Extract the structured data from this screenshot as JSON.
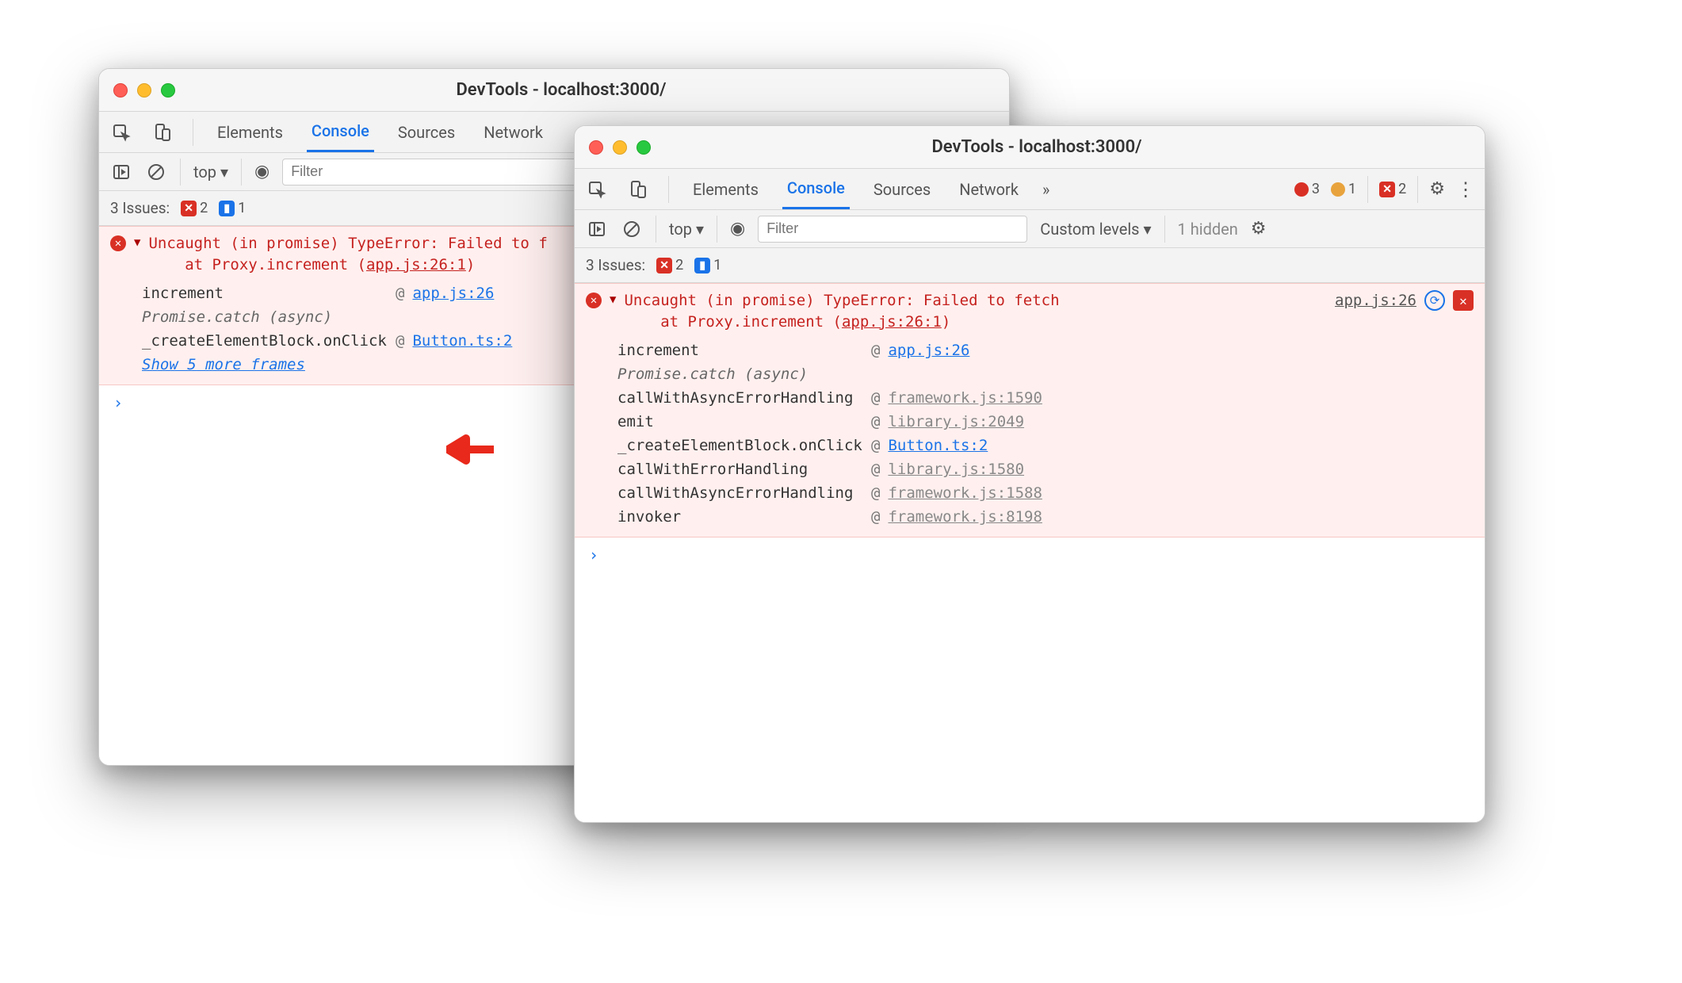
{
  "common": {
    "title": "DevTools - localhost:3000/",
    "tabs": [
      "Elements",
      "Console",
      "Sources",
      "Network"
    ],
    "active_tab": "Console",
    "filter_placeholder": "Filter",
    "context": "top",
    "issues_label": "3 Issues:",
    "issues_err": "2",
    "issues_info": "1",
    "more_glyph": "»"
  },
  "w1": {
    "error_headline": "Uncaught (in promise) TypeError: Failed to f",
    "error_at": "at Proxy.increment (",
    "error_at_loc": "app.js:26:1",
    "stack": [
      {
        "fn": "increment",
        "at": "@",
        "link": "app.js:26",
        "gray": false
      },
      {
        "fn": "Promise.catch (async)",
        "italic": true
      },
      {
        "fn": "_createElementBlock.onClick",
        "at": "@",
        "link": "Button.ts:2",
        "gray": false
      }
    ],
    "show_more": "Show 5 more frames",
    "prompt": "›"
  },
  "w2": {
    "badges": {
      "err": "3",
      "warn": "1",
      "err2": "2"
    },
    "levels": "Custom levels",
    "hidden": "1 hidden",
    "src_right": "app.js:26",
    "error_headline": "Uncaught (in promise) TypeError: Failed to fetch",
    "error_at": "at Proxy.increment (",
    "error_at_loc": "app.js:26:1",
    "stack": [
      {
        "fn": "increment",
        "at": "@",
        "link": "app.js:26",
        "gray": false
      },
      {
        "fn": "Promise.catch (async)",
        "italic": true
      },
      {
        "fn": "callWithAsyncErrorHandling",
        "at": "@",
        "link": "framework.js:1590",
        "gray": true
      },
      {
        "fn": "emit",
        "at": "@",
        "link": "library.js:2049",
        "gray": true
      },
      {
        "fn": "_createElementBlock.onClick",
        "at": "@",
        "link": "Button.ts:2",
        "gray": false
      },
      {
        "fn": "callWithErrorHandling",
        "at": "@",
        "link": "library.js:1580",
        "gray": true
      },
      {
        "fn": "callWithAsyncErrorHandling",
        "at": "@",
        "link": "framework.js:1588",
        "gray": true
      },
      {
        "fn": "invoker",
        "at": "@",
        "link": "framework.js:8198",
        "gray": true
      }
    ],
    "prompt": "›"
  }
}
